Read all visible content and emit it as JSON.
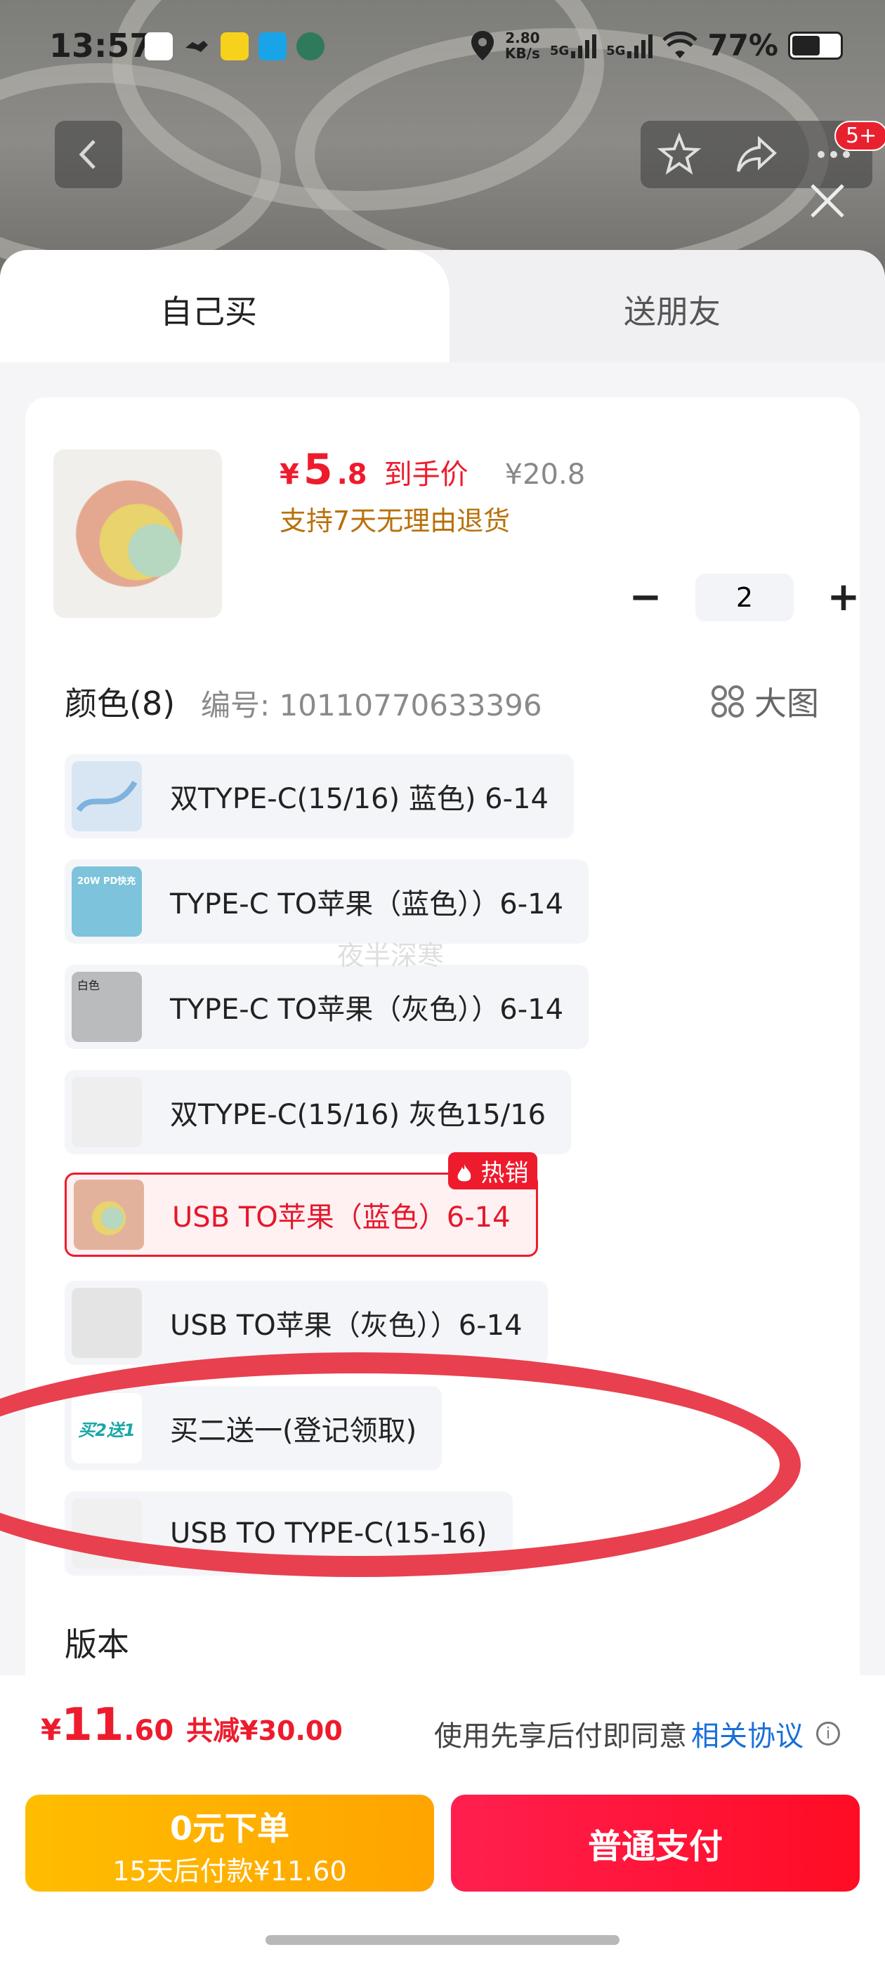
{
  "status_bar": {
    "time": "13:57",
    "net_speed_value": "2.80",
    "net_speed_unit": "KB/s",
    "sig1": "5G",
    "sig2": "5G",
    "battery": "77%"
  },
  "header": {
    "cart_badge": "5+"
  },
  "tabs": [
    {
      "label": "自己买"
    },
    {
      "label": "送朋友"
    }
  ],
  "product": {
    "currency": "¥",
    "price_int": "5",
    "price_dec": ".8",
    "price_label": "到手价",
    "original_price": "¥20.8",
    "return_policy": "支持7天无理由退货",
    "quantity": "2"
  },
  "color_section": {
    "title": "颜色(8)",
    "code": "编号: 10110770633396",
    "big_view": "大图",
    "options": [
      {
        "label": "双TYPE-C(15/16) 蓝色) 6-14"
      },
      {
        "label": "TYPE-C TO苹果（蓝色））6-14"
      },
      {
        "label": "TYPE-C TO苹果（灰色））6-14"
      },
      {
        "label": "双TYPE-C(15/16) 灰色15/16"
      },
      {
        "label": "USB TO苹果（蓝色）6-14",
        "hot": "热销"
      },
      {
        "label": "USB TO苹果（灰色））6-14"
      },
      {
        "label": "买二送一(登记领取)"
      },
      {
        "label": "USB TO TYPE-C(15-16)"
      }
    ],
    "thumb_texts": {
      "t1": "20W PD快充",
      "t2": "白色",
      "t6": "买2送1"
    }
  },
  "version_section": {
    "title": "版本"
  },
  "watermark": "夜半深寒",
  "bottom": {
    "currency": "¥",
    "total_int": "11",
    "total_dec": ".60",
    "discount": "共减¥30.00",
    "agree_text": "使用先享后付即同意",
    "agree_link": "相关协议",
    "zero_btn_line1": "0元下单",
    "zero_btn_line2": "15天后付款¥11.60",
    "pay_btn": "普通支付"
  },
  "colors": {
    "accent_red": "#ee1b2d",
    "gold": "#b8700a",
    "link_blue": "#1a6fd8"
  }
}
